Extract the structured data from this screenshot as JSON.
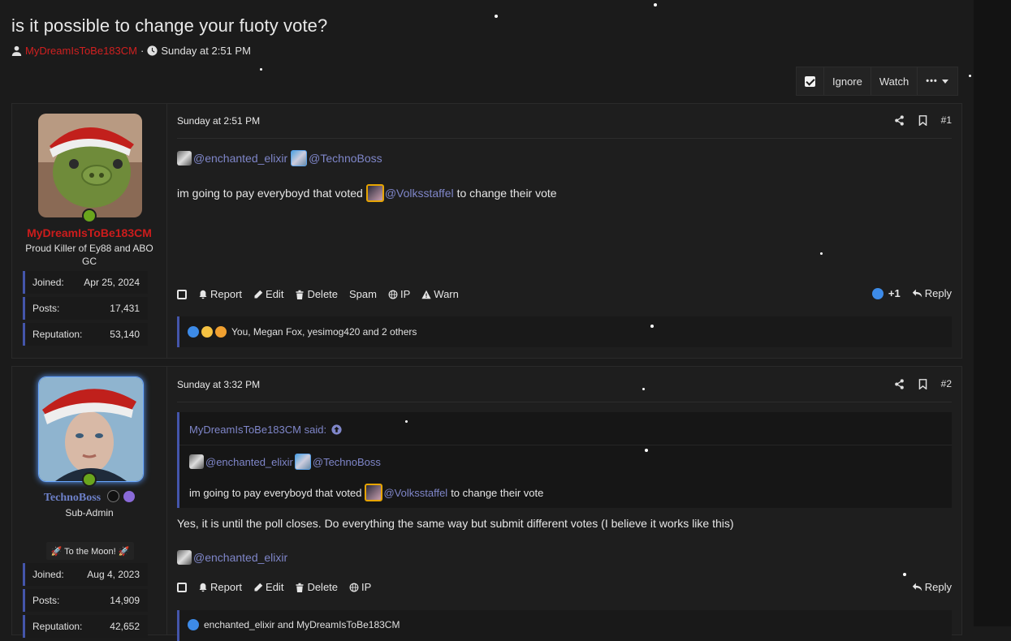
{
  "thread": {
    "title": "is it possible to change your fuoty vote?",
    "author": "MyDreamIsToBe183CM",
    "separator": "·",
    "date": "Sunday at 2:51 PM"
  },
  "toolbar": {
    "ignore": "Ignore",
    "watch": "Watch",
    "more": "•••"
  },
  "posts": [
    {
      "time": "Sunday at 2:51 PM",
      "number": "#1",
      "user": {
        "name": "MyDreamIsToBe183CM",
        "name_color": "#cc1c1c",
        "title": "Proud Killer of Ey88 and ABO GC",
        "stats": [
          {
            "label": "Joined:",
            "value": "Apr 25, 2024"
          },
          {
            "label": "Posts:",
            "value": "17,431"
          },
          {
            "label": "Reputation:",
            "value": "53,140"
          }
        ]
      },
      "mentions": [
        "@enchanted_elixir",
        "@TechnoBoss"
      ],
      "body_before": "im going to pay everyboyd that voted",
      "body_mention": "@Volksstaffel",
      "body_after": "to change their vote",
      "actions": [
        "Report",
        "Edit",
        "Delete",
        "Spam",
        "IP",
        "Warn"
      ],
      "like_count": "+1",
      "reply": "Reply",
      "reactions_text": "You, Megan Fox, yesimog420 and 2 others"
    },
    {
      "time": "Sunday at 3:32 PM",
      "number": "#2",
      "user": {
        "name": "TechnoBoss",
        "name_color": "#6d80c8",
        "title": "Sub-Admin",
        "badge": "🚀 To the Moon! 🚀",
        "stats": [
          {
            "label": "Joined:",
            "value": "Aug 4, 2023"
          },
          {
            "label": "Posts:",
            "value": "14,909"
          },
          {
            "label": "Reputation:",
            "value": "42,652"
          }
        ]
      },
      "quote": {
        "header": "MyDreamIsToBe183CM said:",
        "mentions": [
          "@enchanted_elixir",
          "@TechnoBoss"
        ],
        "body_before": "im going to pay everyboyd that voted",
        "body_mention": "@Volksstaffel",
        "body_after": "to change their vote"
      },
      "body": "Yes, it is until the poll closes. Do everything the same way but submit different votes (I believe it works like this)",
      "mention_below": "@enchanted_elixir",
      "actions": [
        "Report",
        "Edit",
        "Delete",
        "IP"
      ],
      "reply": "Reply",
      "reactions_text": "enchanted_elixir and MyDreamIsToBe183CM"
    }
  ]
}
